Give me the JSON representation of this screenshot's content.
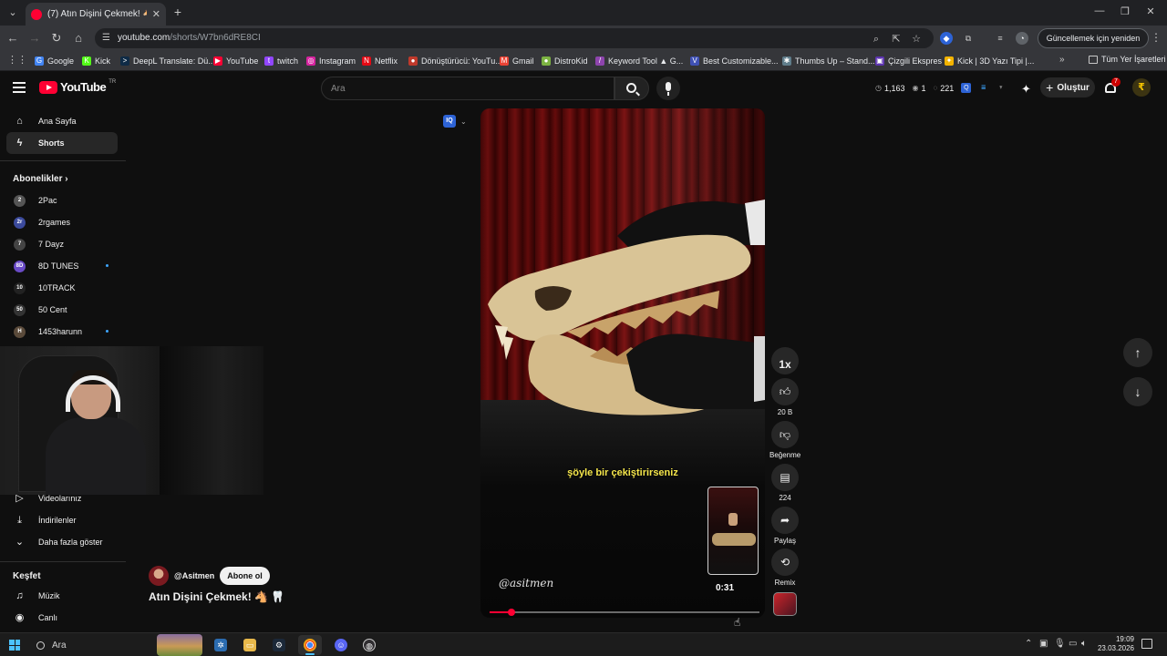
{
  "browser": {
    "tab_title": "(7) Atın Dişini Çekmek! 🐴 🦷",
    "url_domain": "youtube.com",
    "url_path": "/shorts/W7bn6dRE8CI",
    "update_button": "Güncellemek için yeniden başlat",
    "bookmarks": [
      {
        "label": "Google",
        "color": "#4285f4",
        "glyph": "G"
      },
      {
        "label": "Kick",
        "color": "#53fc18",
        "glyph": "K"
      },
      {
        "label": "DeepL Translate: Dü...",
        "color": "#0f2b46",
        "glyph": ">"
      },
      {
        "label": "YouTube",
        "color": "#ff0033",
        "glyph": "▶"
      },
      {
        "label": "twitch",
        "color": "#9146ff",
        "glyph": "t"
      },
      {
        "label": "Instagram",
        "color": "#d6249f",
        "glyph": "◎"
      },
      {
        "label": "Netflix",
        "color": "#e50914",
        "glyph": "N"
      },
      {
        "label": "Dönüştürücü: YouTu...",
        "color": "#c0392b",
        "glyph": "●"
      },
      {
        "label": "Gmail",
        "color": "#ea4335",
        "glyph": "M"
      },
      {
        "label": "DistroKid",
        "color": "#7cb342",
        "glyph": "●"
      },
      {
        "label": "Keyword Tool ▲ G...",
        "color": "#8e44ad",
        "glyph": "/"
      },
      {
        "label": "Best Customizable...",
        "color": "#3f51b5",
        "glyph": "V"
      },
      {
        "label": "Thumbs Up – Stand...",
        "color": "#607d8b",
        "glyph": "✱"
      },
      {
        "label": "Çizgili Ekspres",
        "color": "#5e35b1",
        "glyph": "▣"
      },
      {
        "label": "Kick | 3D Yazı Tipi |...",
        "color": "#f4b400",
        "glyph": "✦"
      }
    ],
    "all_bookmarks": "Tüm Yer İşaretleri"
  },
  "youtube": {
    "logo": "YouTube",
    "country_code": "TR",
    "search_placeholder": "Ara",
    "stats": {
      "a": "1,163",
      "b": "1",
      "c": "221"
    },
    "create_label": "Oluştur",
    "notification_count": "7"
  },
  "sidebar": {
    "top": [
      {
        "label": "Ana Sayfa",
        "icon": "home-icon",
        "glyph": "⌂"
      },
      {
        "label": "Shorts",
        "icon": "shorts-icon",
        "glyph": "ϟ"
      }
    ],
    "subscriptions_header": "Abonelikler",
    "subscriptions": [
      {
        "label": "2Pac",
        "color": "#555555",
        "glyph": "2"
      },
      {
        "label": "2rgames",
        "color": "#3b4a9c",
        "glyph": "2r"
      },
      {
        "label": "7 Dayz",
        "color": "#444444",
        "glyph": "7"
      },
      {
        "label": "8D TUNES",
        "color": "#6a4bc7",
        "glyph": "8D"
      },
      {
        "label": "10TRACK",
        "color": "#222222",
        "glyph": "10"
      },
      {
        "label": "50 Cent",
        "color": "#333333",
        "glyph": "50"
      },
      {
        "label": "1453harunn",
        "color": "#5a4a3a",
        "glyph": "H"
      }
    ],
    "lower": [
      {
        "label": "Videolarınız",
        "icon": "your-videos-icon",
        "glyph": "▷"
      },
      {
        "label": "İndirilenler",
        "icon": "downloads-icon",
        "glyph": "⤓"
      },
      {
        "label": "Daha fazla göster",
        "icon": "chevron-down-icon",
        "glyph": "⌄"
      }
    ],
    "explore_header": "Keşfet",
    "explore": [
      {
        "label": "Müzik",
        "icon": "music-icon",
        "glyph": "♫"
      },
      {
        "label": "Canlı",
        "icon": "live-icon",
        "glyph": "◉"
      }
    ]
  },
  "short": {
    "subtitle": "şöyle bir çekiştirirseniz",
    "watermark": "@asitmen",
    "time": "0:31",
    "progress": 0.08,
    "channel_handle": "@Asitmen",
    "subscribe_label": "Abone ol",
    "title": "Atın Dişini Çekmek! 🐴 🦷"
  },
  "actions": {
    "speed": "1x",
    "likes": "20 B",
    "dislike": "Beğenme",
    "comments": "224",
    "share": "Paylaş",
    "remix": "Remix"
  },
  "taskbar": {
    "search_placeholder": "Ara",
    "time": "19:09",
    "date": "23.03.2026"
  }
}
